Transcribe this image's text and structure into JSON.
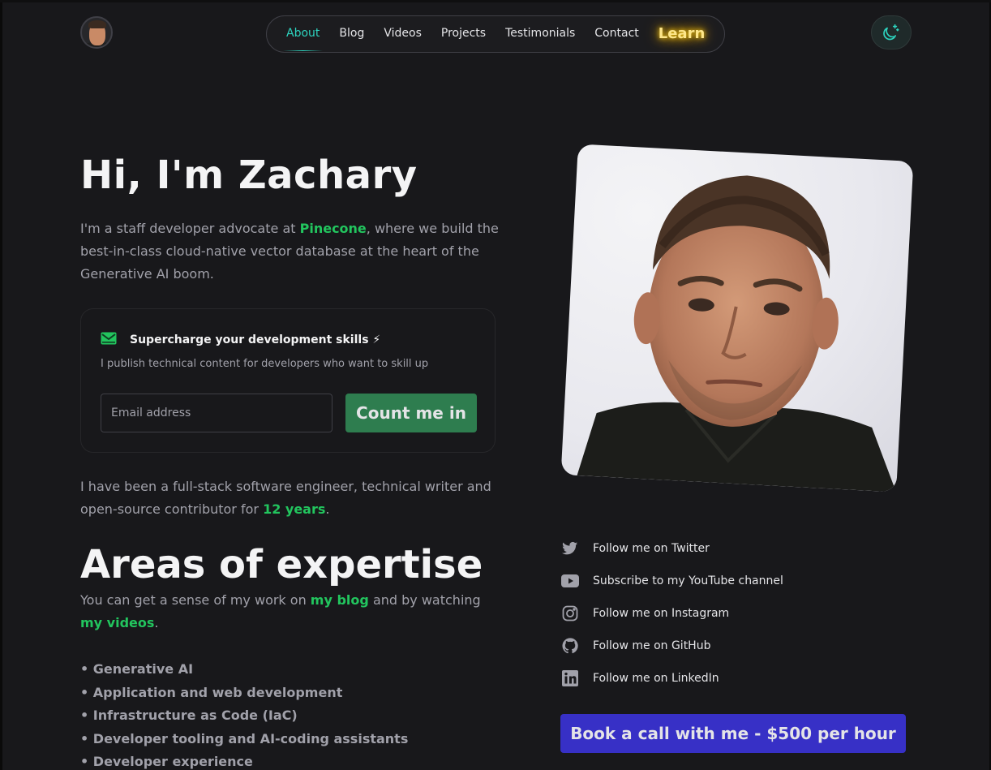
{
  "header": {
    "nav": [
      {
        "label": "About",
        "active": true
      },
      {
        "label": "Blog"
      },
      {
        "label": "Videos"
      },
      {
        "label": "Projects"
      },
      {
        "label": "Testimonials"
      },
      {
        "label": "Contact"
      }
    ],
    "learn_label": "Learn",
    "theme_icon": "moon-sparkle-icon"
  },
  "hero": {
    "title": "Hi, I'm Zachary",
    "intro_before": "I'm a staff developer advocate at ",
    "intro_highlight": "Pinecone",
    "intro_after": ", where we build the best-in-class cloud-native vector database at the heart of the Generative AI boom."
  },
  "newsletter": {
    "title": "Supercharge your development skills ⚡",
    "subtitle": "I publish technical content for developers who want to skill up",
    "email_placeholder": "Email address",
    "button_label": "Count me in"
  },
  "experience": {
    "text_before": "I have been a full-stack software engineer, technical writer and open-source contributor for ",
    "highlight": "12 years",
    "text_after": "."
  },
  "areas": {
    "title": "Areas of expertise",
    "intro_before": "You can get a sense of my work on ",
    "blog_link": "my blog",
    "intro_middle": " and by watching ",
    "videos_link": "my videos",
    "intro_after": ".",
    "items": [
      "Generative AI",
      "Application and web development",
      "Infrastructure as Code (IaC)",
      "Developer tooling and AI-coding assistants",
      "Developer experience"
    ]
  },
  "social": [
    {
      "label": "Follow me on Twitter",
      "icon": "twitter-icon"
    },
    {
      "label": "Subscribe to my YouTube channel",
      "icon": "youtube-icon"
    },
    {
      "label": "Follow me on Instagram",
      "icon": "instagram-icon"
    },
    {
      "label": "Follow me on GitHub",
      "icon": "github-icon"
    },
    {
      "label": "Follow me on LinkedIn",
      "icon": "linkedin-icon"
    }
  ],
  "book_call_label": "Book a call with me - $500 per hour",
  "colors": {
    "background": "#18181b",
    "accent_green": "#22c55e",
    "nav_active": "#2dd4bf",
    "cta_green": "#2e7d4f",
    "cta_indigo": "#3730c6"
  }
}
